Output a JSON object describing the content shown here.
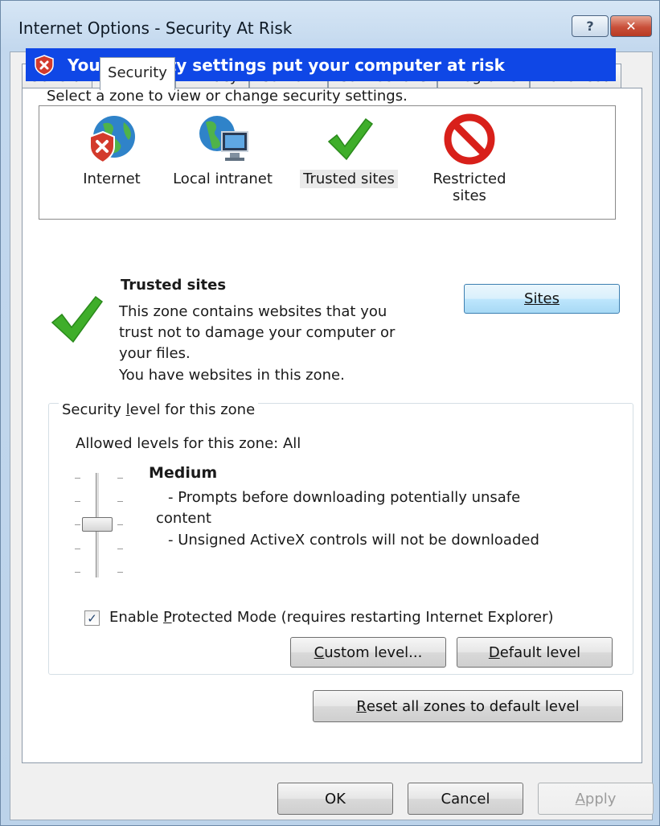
{
  "window": {
    "title": "Internet Options - Security At Risk",
    "help_label": "?",
    "close_label": "✕"
  },
  "tabs": [
    "General",
    "Security",
    "Privacy",
    "Content",
    "Connections",
    "Programs",
    "Advanced"
  ],
  "warning": {
    "text": "Your security settings put your computer at risk"
  },
  "zones": {
    "instruction": "Select a zone to view or change security settings.",
    "items": [
      {
        "label": "Internet",
        "icon": "globe-shield-icon"
      },
      {
        "label": "Local intranet",
        "icon": "globe-computer-icon"
      },
      {
        "label": "Trusted sites",
        "icon": "checkmark-icon"
      },
      {
        "label": "Restricted",
        "label2": "sites",
        "icon": "restricted-icon"
      }
    ],
    "selected": "Trusted sites"
  },
  "zone_info": {
    "title": "Trusted sites",
    "desc_lines": [
      "This zone contains websites that you",
      "trust not to damage your computer or",
      "your files.",
      "You have websites in this zone."
    ],
    "sites_button": "Sites"
  },
  "security_level": {
    "group_label_pre": "Security ",
    "group_label_u": "l",
    "group_label_post": "evel for this zone",
    "allowed": "Allowed levels for this zone: All",
    "level_name": "Medium",
    "desc_lines": [
      "- Prompts before downloading potentially unsafe",
      "content",
      "- Unsigned ActiveX controls will not be downloaded"
    ],
    "protected_mode_checked": true,
    "protected_pre": "Enable ",
    "protected_u": "P",
    "protected_post": "rotected Mode (requires restarting Internet Explorer)",
    "custom_u": "C",
    "custom_rest": "ustom level...",
    "default_u": "D",
    "default_rest": "efault level"
  },
  "reset": {
    "u": "R",
    "rest": "eset all zones to default level"
  },
  "footer": {
    "ok": "OK",
    "cancel": "Cancel",
    "apply_u": "A",
    "apply_rest": "pply"
  },
  "colors": {
    "warning_bar": "#0f47e6",
    "close_button": "#c9503a",
    "check_green": "#3fae2a",
    "restricted_red": "#d8201a"
  }
}
